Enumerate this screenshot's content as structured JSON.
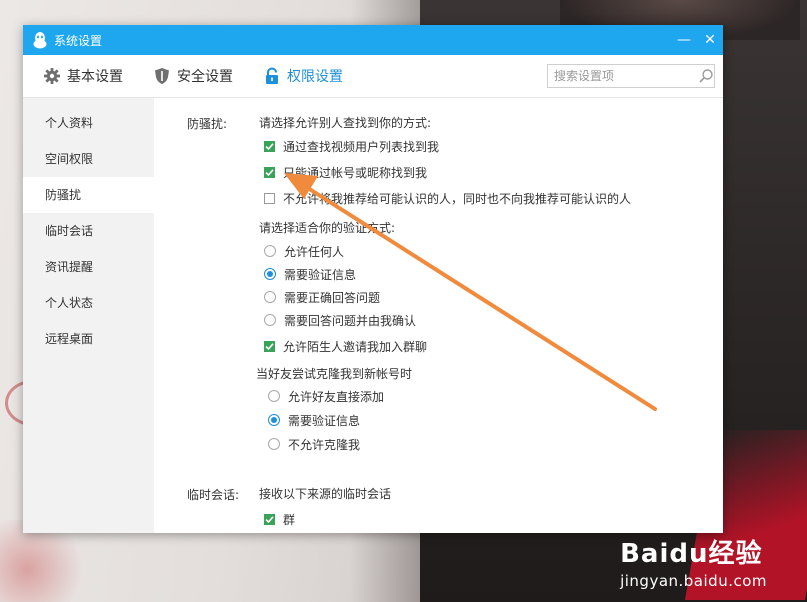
{
  "window": {
    "title": "系统设置"
  },
  "controls": {
    "minimize": "—",
    "close": "✕"
  },
  "tabs": [
    {
      "label": "基本设置",
      "icon": "gear-icon"
    },
    {
      "label": "安全设置",
      "icon": "shield-icon"
    },
    {
      "label": "权限设置",
      "icon": "lock-icon",
      "active": true
    }
  ],
  "search": {
    "placeholder": "搜索设置项",
    "value": ""
  },
  "sidebar": {
    "items": [
      {
        "label": "个人资料"
      },
      {
        "label": "空间权限"
      },
      {
        "label": "防骚扰",
        "active": true
      },
      {
        "label": "临时会话"
      },
      {
        "label": "资讯提醒"
      },
      {
        "label": "个人状态"
      },
      {
        "label": "远程桌面"
      }
    ]
  },
  "content": {
    "harass": {
      "label": "防骚扰:",
      "find_prompt": "请选择允许别人查找到你的方式:",
      "find_options": [
        {
          "label": "通过查找视频用户列表找到我",
          "checked": true
        },
        {
          "label": "只能通过帐号或昵称找到我",
          "checked": true
        },
        {
          "label": "不允许将我推荐给可能认识的人，同时也不向我推荐可能认识的人",
          "checked": false
        }
      ],
      "verify_prompt": "请选择适合你的验证方式:",
      "verify_options": [
        {
          "label": "允许任何人",
          "selected": false
        },
        {
          "label": "需要验证信息",
          "selected": true
        },
        {
          "label": "需要正确回答问题",
          "selected": false
        },
        {
          "label": "需要回答问题并由我确认",
          "selected": false
        }
      ],
      "group_invite": {
        "label": "允许陌生人邀请我加入群聊",
        "checked": true
      },
      "clone_prompt": "当好友尝试克隆我到新帐号时",
      "clone_options": [
        {
          "label": "允许好友直接添加",
          "selected": false
        },
        {
          "label": "需要验证信息",
          "selected": true
        },
        {
          "label": "不允许克隆我",
          "selected": false
        }
      ]
    },
    "temp_chat": {
      "label": "临时会话:",
      "prompt": "接收以下来源的临时会话",
      "options": [
        {
          "label": "群",
          "checked": true
        }
      ]
    }
  },
  "watermark": {
    "brand": "Baidu经验",
    "url": "jingyan.baidu.com"
  },
  "colors": {
    "titlebar": "#1ea6ee",
    "accent": "#1e8fd9",
    "check": "#3aa35a",
    "arrow": "#f08a3c"
  }
}
